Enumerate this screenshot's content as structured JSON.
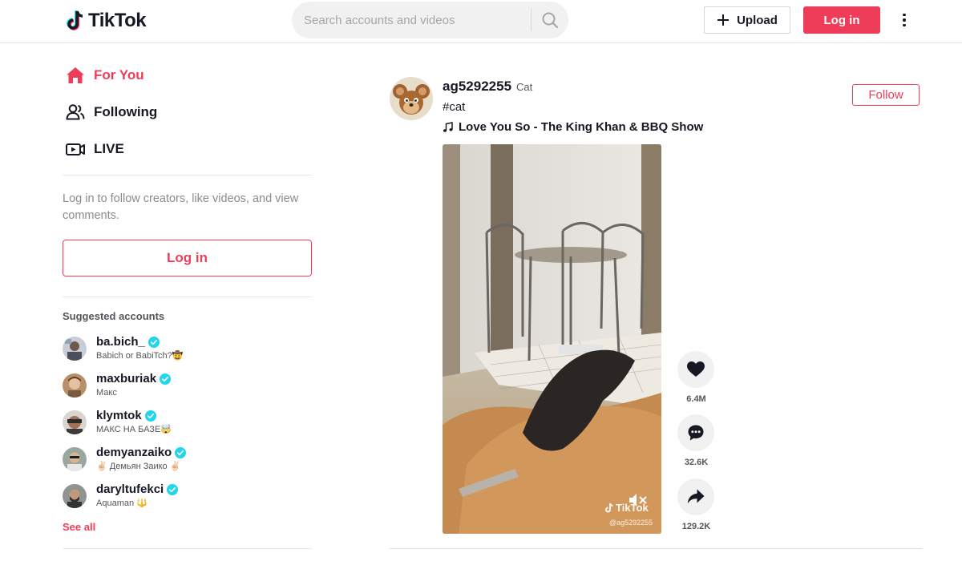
{
  "header": {
    "logo_text": "TikTok",
    "search_placeholder": "Search accounts and videos",
    "upload_label": "Upload",
    "login_label": "Log in"
  },
  "sidebar": {
    "nav": [
      {
        "label": "For You",
        "icon": "home-icon",
        "active": true
      },
      {
        "label": "Following",
        "icon": "users-icon",
        "active": false
      },
      {
        "label": "LIVE",
        "icon": "live-icon",
        "active": false
      }
    ],
    "login_prompt": "Log in to follow creators, like videos, and view comments.",
    "login_button": "Log in",
    "suggested_title": "Suggested accounts",
    "accounts": [
      {
        "username": "ba.bich_",
        "nickname": "Babich or BabiTch?🤠",
        "verified": true
      },
      {
        "username": "maxburiak",
        "nickname": "Макс",
        "verified": true
      },
      {
        "username": "klymtok",
        "nickname": "МАКС НА БАЗЕ🤯",
        "verified": true
      },
      {
        "username": "demyanzaiko",
        "nickname": "✌🏻 Демьян Заико ✌🏻",
        "verified": true
      },
      {
        "username": "daryltufekci",
        "nickname": "Aquaman 🔱",
        "verified": true
      }
    ],
    "see_all": "See all"
  },
  "post": {
    "username": "ag5292255",
    "nickname": "Cat",
    "hashtag": "#cat",
    "music": "Love You So - The King Khan & BBQ Show",
    "follow_label": "Follow",
    "watermark_logo": "TikTok",
    "watermark_user": "@ag5292255",
    "likes": "6.4M",
    "comments": "32.6K",
    "shares": "129.2K"
  },
  "colors": {
    "brand": "#ee3d58",
    "text": "#161823",
    "muted": "#8a8b91",
    "verified": "#20d5ec"
  }
}
